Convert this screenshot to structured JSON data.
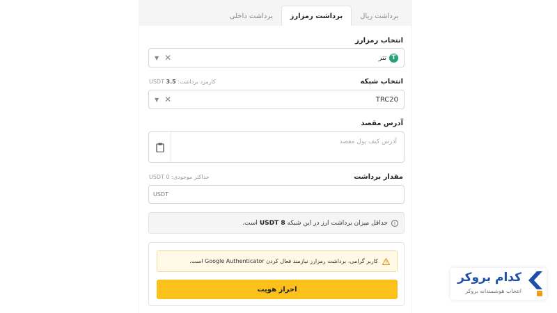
{
  "tabs": [
    {
      "label": "برداشت ریال",
      "active": false
    },
    {
      "label": "برداشت رمزارز",
      "active": true
    },
    {
      "label": "برداشت داخلی",
      "active": false
    }
  ],
  "currency": {
    "label": "انتخاب رمزارز",
    "value": "تتر",
    "coin_symbol": "T",
    "coin_color": "#26a17b"
  },
  "network": {
    "label": "انتخاب شبکه",
    "fee_label": "کارمزد برداشت:",
    "fee_value": "3.5",
    "fee_unit": "USDT",
    "value": "TRC20"
  },
  "destination": {
    "label": "آدرس مقصد",
    "placeholder": "آدرس کیف پول مقصد"
  },
  "amount": {
    "label": "مقدار برداشت",
    "max_label": "حداکثر موجودی: 0 USDT",
    "unit": "USDT"
  },
  "info": {
    "text_before": "حداقل میزان برداشت ارز در این شبکه",
    "min_amount": "8 USDT",
    "text_after": "است."
  },
  "warning": {
    "text": "کاربر گرامی، برداشت رمزارز نیازمند فعال کردن Google Authenticator است."
  },
  "kyc_button_label": "احراز هویت",
  "brand": {
    "name": "کدام بروکر",
    "tagline": "انتخاب هوشمندانه بروکر",
    "primary_color": "#1f4fa8",
    "accent_color": "#fdc11c"
  }
}
